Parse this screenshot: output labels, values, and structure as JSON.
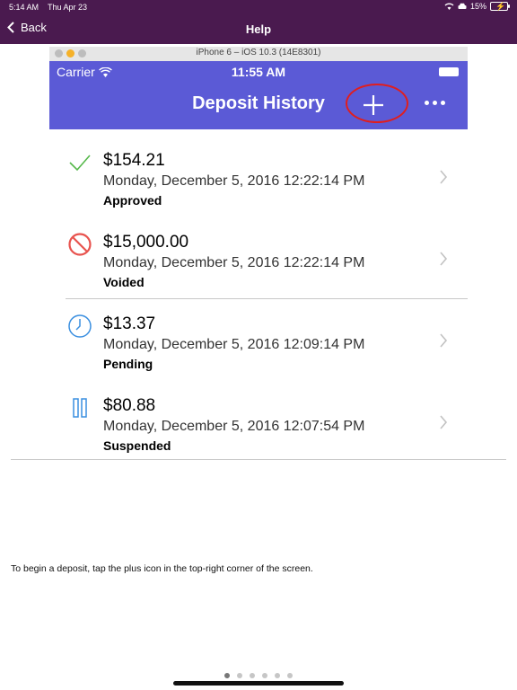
{
  "status_bar": {
    "time": "5:14 AM",
    "date": "Thu Apr 23",
    "battery": "15%"
  },
  "nav": {
    "back_label": "Back",
    "title": "Help"
  },
  "simulator": {
    "window_title": "iPhone 6 – iOS 10.3 (14E8301)"
  },
  "ios": {
    "carrier": "Carrier",
    "time": "11:55 AM",
    "title": "Deposit History"
  },
  "deposits": [
    {
      "amount": "$154.21",
      "date": "Monday, December 5, 2016 12:22:14 PM",
      "status": "Approved",
      "icon": "check-icon",
      "icon_color": "#55b84a"
    },
    {
      "amount": "$15,000.00",
      "date": "Monday, December 5, 2016 12:22:14 PM",
      "status": "Voided",
      "icon": "prohibited-icon",
      "icon_color": "#e8534e"
    },
    {
      "amount": "$13.37",
      "date": "Monday, December 5, 2016 12:09:14 PM",
      "status": "Pending",
      "icon": "clock-icon",
      "icon_color": "#3a8fe0"
    },
    {
      "amount": "$80.88",
      "date": "Monday, December 5, 2016 12:07:54 PM",
      "status": "Suspended",
      "icon": "pause-icon",
      "icon_color": "#3a8fe0"
    }
  ],
  "help_text": "To begin a deposit, tap the plus icon in the top-right corner of the screen.",
  "pager": {
    "count": 6,
    "active_index": 0
  },
  "colors": {
    "app_bar": "#4a1a4f",
    "ios_header": "#5b5ad6",
    "highlight": "#e01e1e"
  }
}
